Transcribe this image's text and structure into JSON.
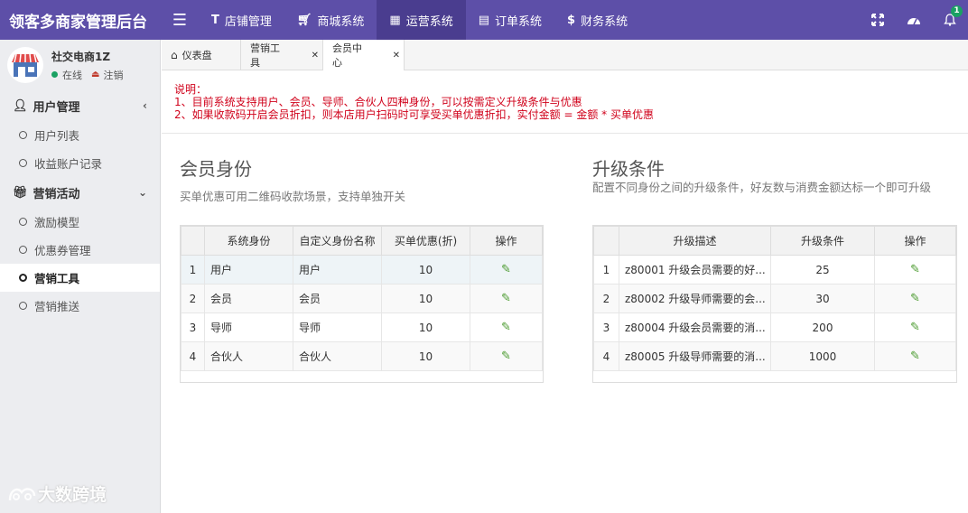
{
  "app": {
    "title": "领客多商家管理后台"
  },
  "topnav": [
    {
      "icon": "text-icon",
      "label": "店铺管理"
    },
    {
      "icon": "cart-icon",
      "label": "商城系统"
    },
    {
      "icon": "grid-icon",
      "label": "运营系统",
      "active": true
    },
    {
      "icon": "list-icon",
      "label": "订单系统"
    },
    {
      "icon": "dollar-icon",
      "label": "财务系统"
    }
  ],
  "topright": {
    "notification_count": "1"
  },
  "user": {
    "name": "社交电商1Z",
    "status": "在线",
    "logout": "注销"
  },
  "sidebar": {
    "groups": [
      {
        "label": "用户管理",
        "items": [
          {
            "label": "用户列表"
          },
          {
            "label": "收益账户记录"
          }
        ]
      },
      {
        "label": "营销活动",
        "items": [
          {
            "label": "激励模型"
          },
          {
            "label": "优惠券管理"
          },
          {
            "label": "营销工具",
            "active": true
          },
          {
            "label": "营销推送"
          }
        ]
      }
    ]
  },
  "watermark": "大数跨境",
  "tabs": [
    {
      "label": "仪表盘"
    },
    {
      "label": "营销工具"
    },
    {
      "label": "会员中心",
      "active": true
    }
  ],
  "notice": {
    "title": "说明：",
    "line1": "1、目前系统支持用户、会员、导师、合伙人四种身份，可以按需定义升级条件与优惠",
    "line2": "2、如果收款码开启会员折扣，则本店用户扫码时可享受买单优惠折扣，实付金额 = 金额 * 买单优惠"
  },
  "member": {
    "title": "会员身份",
    "subtitle": "买单优惠可用二维码收款场景，支持单独开关",
    "headers": [
      "",
      "系统身份",
      "自定义身份名称",
      "买单优惠(折)",
      "操作"
    ],
    "rows": [
      [
        "1",
        "用户",
        "用户",
        "10"
      ],
      [
        "2",
        "会员",
        "会员",
        "10"
      ],
      [
        "3",
        "导师",
        "导师",
        "10"
      ],
      [
        "4",
        "合伙人",
        "合伙人",
        "10"
      ]
    ]
  },
  "upgrade": {
    "title": "升级条件",
    "subtitle": "配置不同身份之间的升级条件，好友数与消费金额达标一个即可升级",
    "headers": [
      "",
      "升级描述",
      "升级条件",
      "操作"
    ],
    "rows": [
      [
        "1",
        "z80001 升级会员需要的好...",
        "25"
      ],
      [
        "2",
        "z80002 升级导师需要的会...",
        "30"
      ],
      [
        "3",
        "z80004 升级会员需要的消...",
        "200"
      ],
      [
        "4",
        "z80005 升级导师需要的消...",
        "1000"
      ]
    ]
  }
}
